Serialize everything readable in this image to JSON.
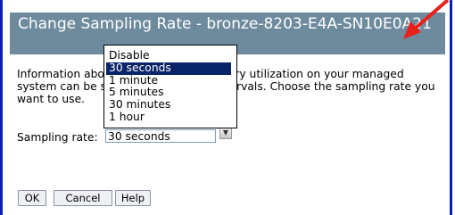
{
  "dialog": {
    "title": "Change Sampling Rate - bronze-8203-E4A-SN10E0A21",
    "description": "Information about processor and memory utilization on your managed system can be sampled at different intervals. Choose the sampling rate you want to use.",
    "sampling_rate_label": "Sampling rate:",
    "selected_value": "30 seconds"
  },
  "dropdown": {
    "options": [
      "Disable",
      "30 seconds",
      "1 minute",
      "5 minutes",
      "30 minutes",
      "1 hour"
    ],
    "highlighted": "30 seconds"
  },
  "buttons": {
    "ok": "OK",
    "cancel": "Cancel",
    "help": "Help"
  },
  "colors": {
    "title_bar": "#6e8b9e",
    "highlight": "#0a246a",
    "frame_border": "#0b1fb8",
    "annotation_arrow": "#e8201a"
  },
  "icons": {
    "select_arrow": "chevron-down-icon",
    "annotation": "red-arrow-icon"
  }
}
